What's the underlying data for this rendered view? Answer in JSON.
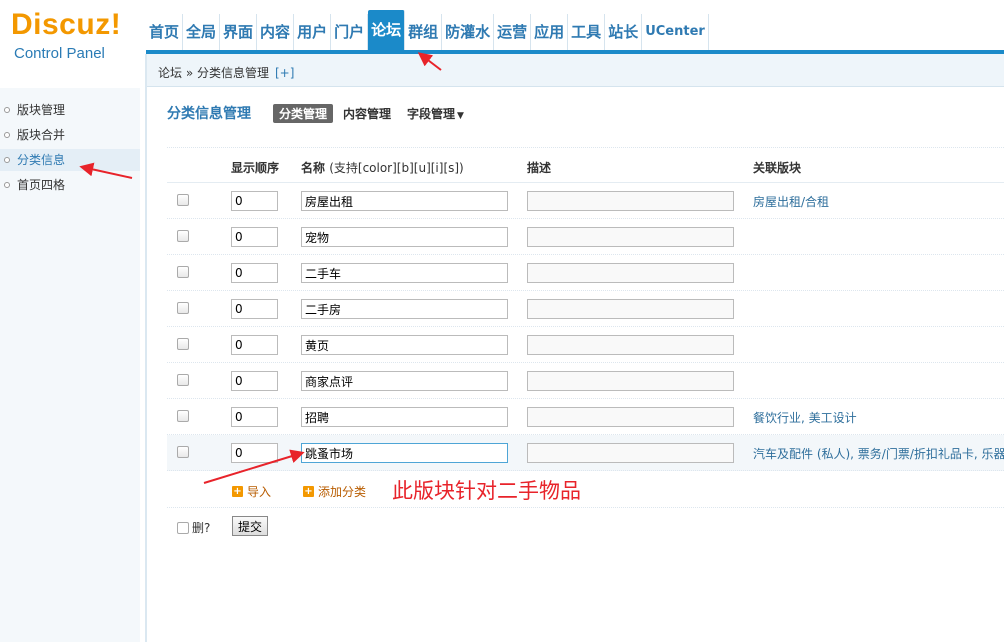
{
  "logo": {
    "main": "Discuz!",
    "sub": "Control Panel"
  },
  "nav": [
    "首页",
    "全局",
    "界面",
    "内容",
    "用户",
    "门户",
    "论坛",
    "群组",
    "防灌水",
    "运营",
    "应用",
    "工具",
    "站长",
    "UCenter"
  ],
  "nav_active": "论坛",
  "breadcrumb": {
    "text": "论坛 » 分类信息管理",
    "plus": "[+]"
  },
  "sidebar": {
    "items": [
      {
        "label": "版块管理"
      },
      {
        "label": "版块合并"
      },
      {
        "label": "分类信息"
      },
      {
        "label": "首页四格"
      }
    ],
    "active": "分类信息"
  },
  "page": {
    "title": "分类信息管理",
    "tabs": [
      "分类管理",
      "内容管理",
      "字段管理"
    ],
    "active_tab": "分类管理"
  },
  "table": {
    "headers": {
      "order": "显示顺序",
      "name": "名称",
      "name_hint": "(支持[color][b][u][i][s])",
      "desc": "描述",
      "forum": "关联版块"
    },
    "rows": [
      {
        "order": "0",
        "name": "房屋出租",
        "desc": "",
        "forum": "房屋出租/合租"
      },
      {
        "order": "0",
        "name": "宠物",
        "desc": "",
        "forum": ""
      },
      {
        "order": "0",
        "name": "二手车",
        "desc": "",
        "forum": ""
      },
      {
        "order": "0",
        "name": "二手房",
        "desc": "",
        "forum": ""
      },
      {
        "order": "0",
        "name": "黄页",
        "desc": "",
        "forum": ""
      },
      {
        "order": "0",
        "name": "商家点评",
        "desc": "",
        "forum": ""
      },
      {
        "order": "0",
        "name": "招聘",
        "desc": "",
        "forum": "餐饮行业, 美工设计"
      },
      {
        "order": "0",
        "name": "跳蚤市场",
        "desc": "",
        "forum": "汽车及配件 (私人), 票务/门票/折扣礼品卡, 乐器"
      }
    ],
    "import_label": "导入",
    "add_label": "添加分类",
    "delete_label": "删?",
    "submit_label": "提交"
  },
  "annotation": {
    "text": "此版块针对二手物品",
    "color": "#e8232a"
  }
}
